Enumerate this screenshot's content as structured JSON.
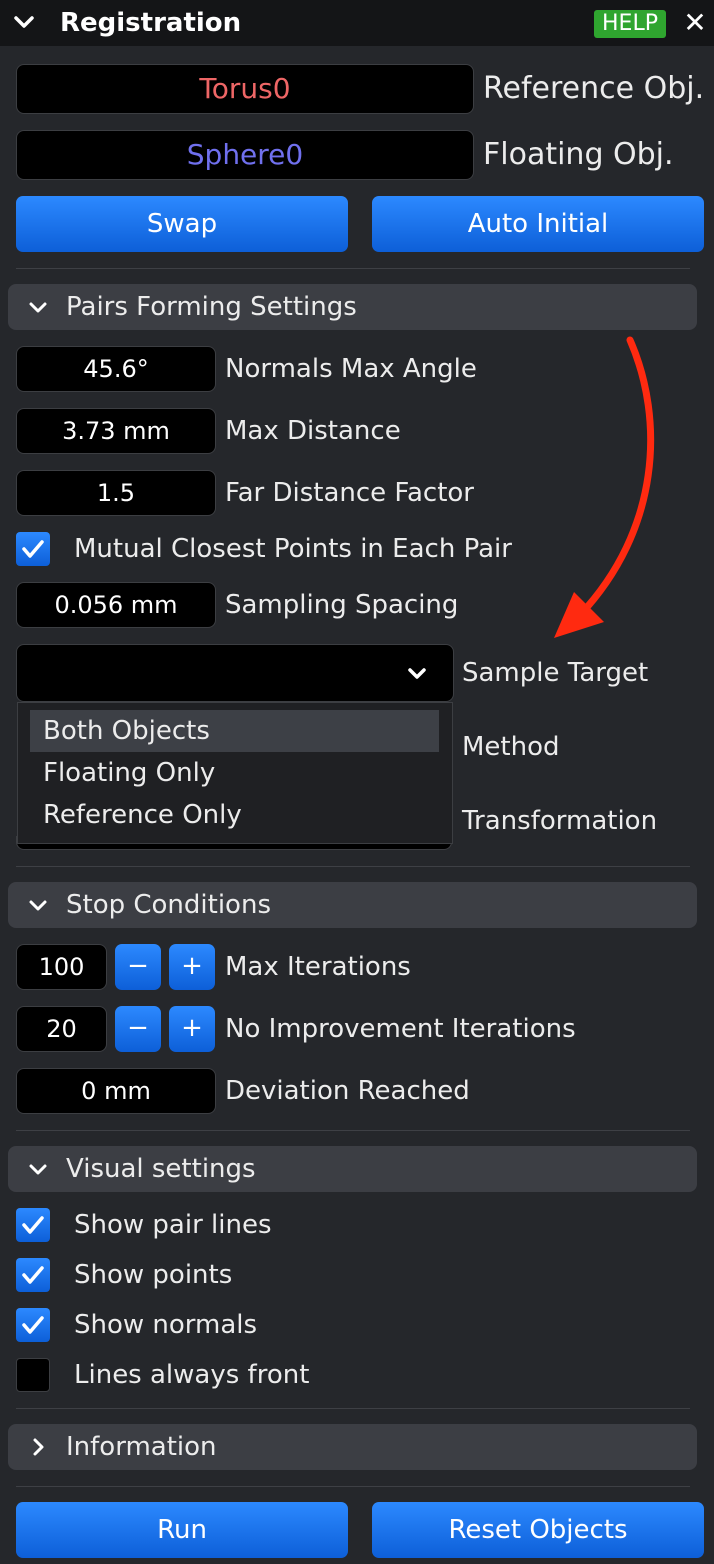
{
  "window": {
    "title": "Registration",
    "help_label": "HELP",
    "close_symbol": "✕",
    "collapse_icon": "chevron-down-icon"
  },
  "objects": {
    "reference_value": "Torus0",
    "reference_label": "Reference Obj.",
    "reference_color": "#ee6666",
    "floating_value": "Sphere0",
    "floating_label": "Floating Obj.",
    "floating_color": "#7070ee"
  },
  "actions": {
    "swap_label": "Swap",
    "auto_initial_label": "Auto Initial"
  },
  "pairs_forming": {
    "title": "Pairs Forming Settings",
    "expanded": true,
    "normals_max_angle_value": "45.6°",
    "normals_max_angle_label": "Normals Max Angle",
    "max_distance_value": "3.73 mm",
    "max_distance_label": "Max Distance",
    "far_distance_factor_value": "1.5",
    "far_distance_factor_label": "Far Distance Factor",
    "mutual_closest_label": "Mutual Closest Points in Each Pair",
    "mutual_closest_checked": true,
    "sampling_spacing_value": "0.056 mm",
    "sampling_spacing_label": "Sampling Spacing",
    "sample_target_label": "Sample Target",
    "sample_target_options": [
      "Both Objects",
      "Floating Only",
      "Reference Only"
    ],
    "sample_target_highlighted": "Both Objects",
    "method_label": "Method",
    "transformation_label": "Transformation"
  },
  "stop_conditions": {
    "title": "Stop Conditions",
    "expanded": true,
    "max_iterations_value": "100",
    "max_iterations_label": "Max Iterations",
    "no_improvement_value": "20",
    "no_improvement_label": "No Improvement Iterations",
    "deviation_value": "0 mm",
    "deviation_label": "Deviation Reached",
    "minus_symbol": "−",
    "plus_symbol": "+"
  },
  "visual_settings": {
    "title": "Visual settings",
    "expanded": true,
    "items": [
      {
        "label": "Show pair lines",
        "checked": true
      },
      {
        "label": "Show points",
        "checked": true
      },
      {
        "label": "Show normals",
        "checked": true
      },
      {
        "label": "Lines always front",
        "checked": false
      }
    ]
  },
  "information": {
    "title": "Information",
    "expanded": false
  },
  "footer": {
    "run_label": "Run",
    "reset_label": "Reset Objects"
  },
  "colors": {
    "panel_bg": "#25272b",
    "title_bg": "#141517",
    "accent_blue": "#1a73ec",
    "help_green": "#2fa52f",
    "annotation_red": "#ff2a10"
  }
}
